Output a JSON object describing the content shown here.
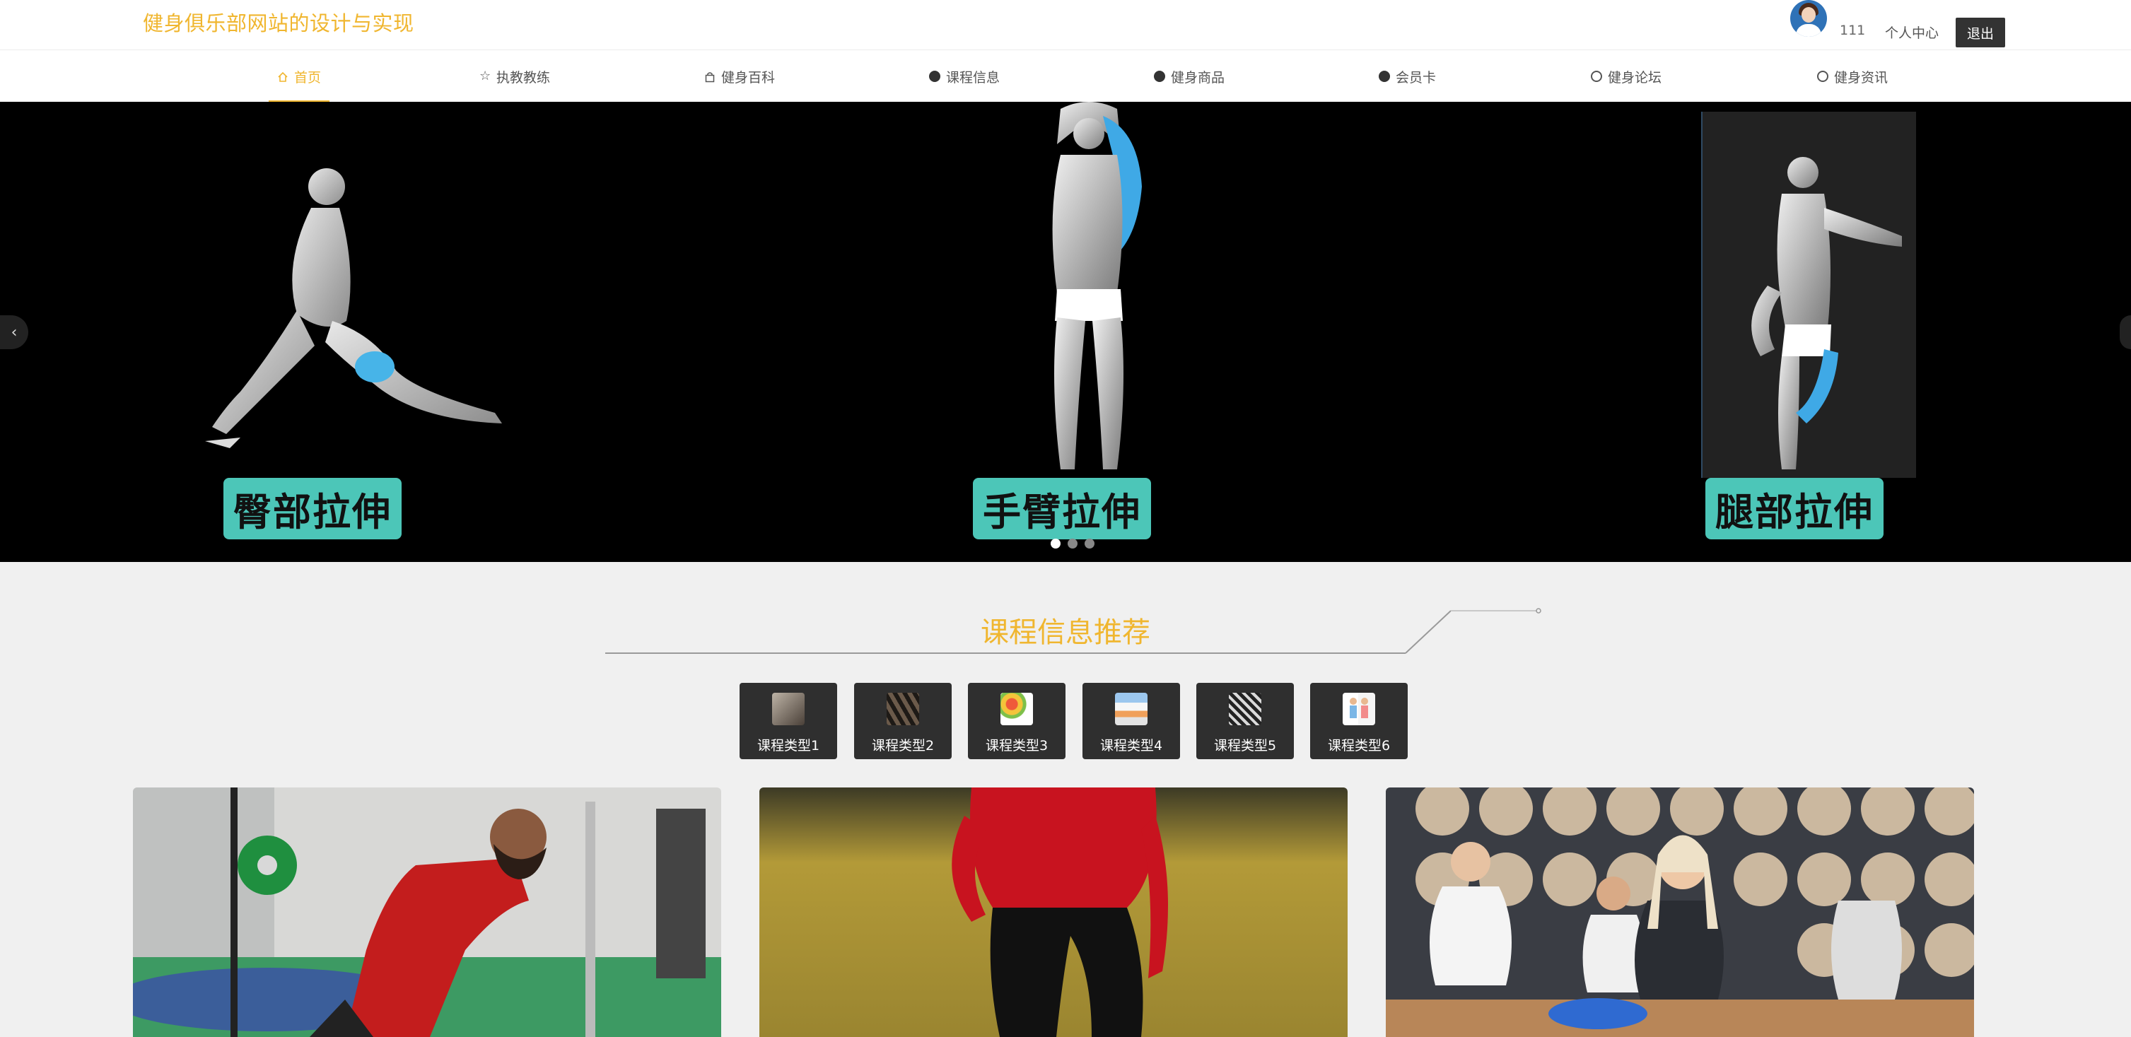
{
  "site": {
    "title": "健身俱乐部网站的设计与实现"
  },
  "user": {
    "name": "111",
    "profile_label": "个人中心",
    "logout_label": "退出"
  },
  "nav": {
    "items": [
      {
        "label": "首页",
        "icon": "home-icon",
        "active": true
      },
      {
        "label": "执教教练",
        "icon": "star-icon"
      },
      {
        "label": "健身百科",
        "icon": "bag-icon"
      },
      {
        "label": "课程信息",
        "icon": "info-icon"
      },
      {
        "label": "健身商品",
        "icon": "question-icon"
      },
      {
        "label": "会员卡",
        "icon": "info-icon"
      },
      {
        "label": "健身论坛",
        "icon": "globe-icon"
      },
      {
        "label": "健身资讯",
        "icon": "smile-icon"
      }
    ]
  },
  "banner": {
    "captions": [
      "臀部拉伸",
      "手臂拉伸",
      "腿部拉伸"
    ],
    "dots": 3,
    "active_dot": 0
  },
  "section": {
    "title": "课程信息推荐"
  },
  "categories": [
    {
      "label": "课程类型1"
    },
    {
      "label": "课程类型2"
    },
    {
      "label": "课程类型3"
    },
    {
      "label": "课程类型4"
    },
    {
      "label": "课程类型5"
    },
    {
      "label": "课程类型6"
    }
  ],
  "colors": {
    "accent": "#f0b62f",
    "banner_bg": "#000000",
    "caption_bg": "#4cc6b8",
    "tile_bg": "#2f2f2f"
  }
}
